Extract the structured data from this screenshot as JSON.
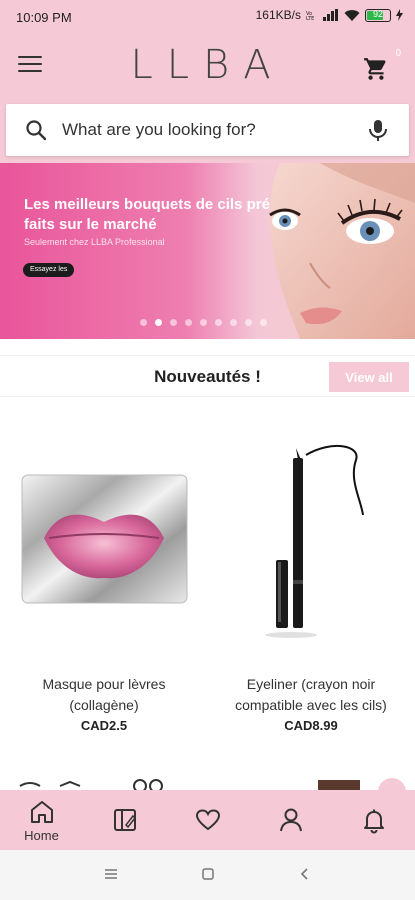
{
  "status": {
    "time": "10:09 PM",
    "speed": "161KB/s",
    "battery_text": "92"
  },
  "header": {
    "logo": "LLBA",
    "cart_count": "0"
  },
  "search": {
    "placeholder": "What are you looking for?"
  },
  "banner": {
    "headline": "Les meilleurs bouquets de cils pré faits sur le marché",
    "subtitle": "Seulement chez LLBA Professional",
    "cta": "Essayez les",
    "slide_count": 9,
    "active_slide": 2
  },
  "section": {
    "title": "Nouveautés !",
    "view_all": "View all"
  },
  "products": [
    {
      "name": "Masque pour lèvres (collagène)",
      "price": "CAD2.5"
    },
    {
      "name": "Eyeliner (crayon noir compatible avec les cils)",
      "price": "CAD8.99"
    }
  ],
  "bottom_nav": {
    "items": [
      {
        "label": "Home",
        "icon": "home-icon",
        "active": true
      },
      {
        "label": "",
        "icon": "catalog-icon"
      },
      {
        "label": "",
        "icon": "heart-icon"
      },
      {
        "label": "",
        "icon": "user-icon"
      },
      {
        "label": "",
        "icon": "bell-icon"
      }
    ]
  },
  "colors": {
    "brand_pink": "#f5c9d5",
    "banner_pink": "#e9559a",
    "battery_green": "#2fb84a"
  }
}
